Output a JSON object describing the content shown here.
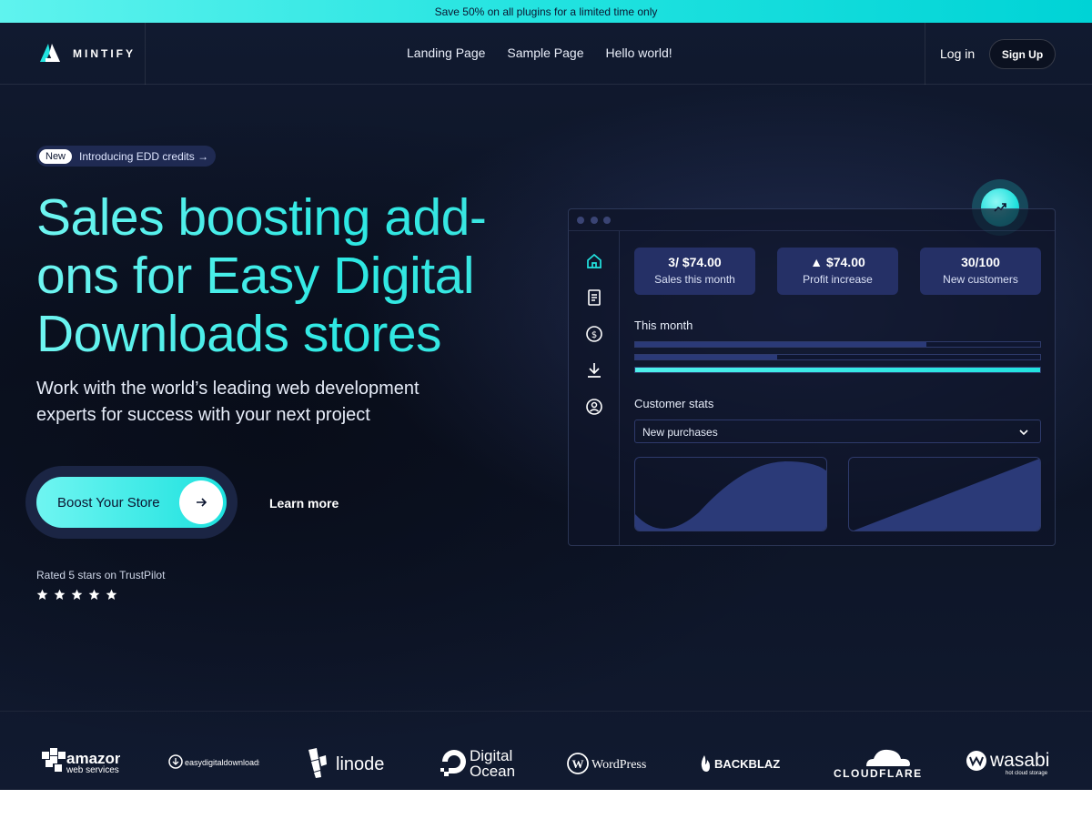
{
  "promo": {
    "text": "Save 50% on all plugins for a limited time only"
  },
  "brand": {
    "name": "MINTIFY"
  },
  "nav": {
    "items": [
      "Landing Page",
      "Sample Page",
      "Hello world!"
    ]
  },
  "auth": {
    "login": "Log in",
    "signup": "Sign Up"
  },
  "badge": {
    "tag": "New",
    "text": "Introducing EDD credits →"
  },
  "hero": {
    "headline": "Sales boosting add-ons for Easy Digital Downloads stores",
    "subhead": "Work with the world’s leading web development experts for success with your next project",
    "cta_label": "Boost Your Store",
    "learn_more": "Learn more",
    "rating_text": "Rated 5 stars on TrustPilot",
    "stars": 5
  },
  "dashboard": {
    "stats": [
      {
        "value": "3/ $74.00",
        "label": "Sales this month"
      },
      {
        "value": "▲ $74.00",
        "label": "Profit increase"
      },
      {
        "value": "30/100",
        "label": "New customers"
      }
    ],
    "month_label": "This month",
    "month_bars": [
      0.72,
      0.35,
      1.0
    ],
    "customer_stats_label": "Customer stats",
    "select_value": "New purchases"
  },
  "logos": [
    "amazon web services",
    "easydigitaldownloads",
    "linode",
    "Digital Ocean",
    "WordPress",
    "BACKBLAZE",
    "CLOUDFLARE",
    "wasabi hot cloud storage"
  ],
  "colors": {
    "accent": "#22e3e0",
    "background": "#0b1222",
    "card": "#253066"
  }
}
